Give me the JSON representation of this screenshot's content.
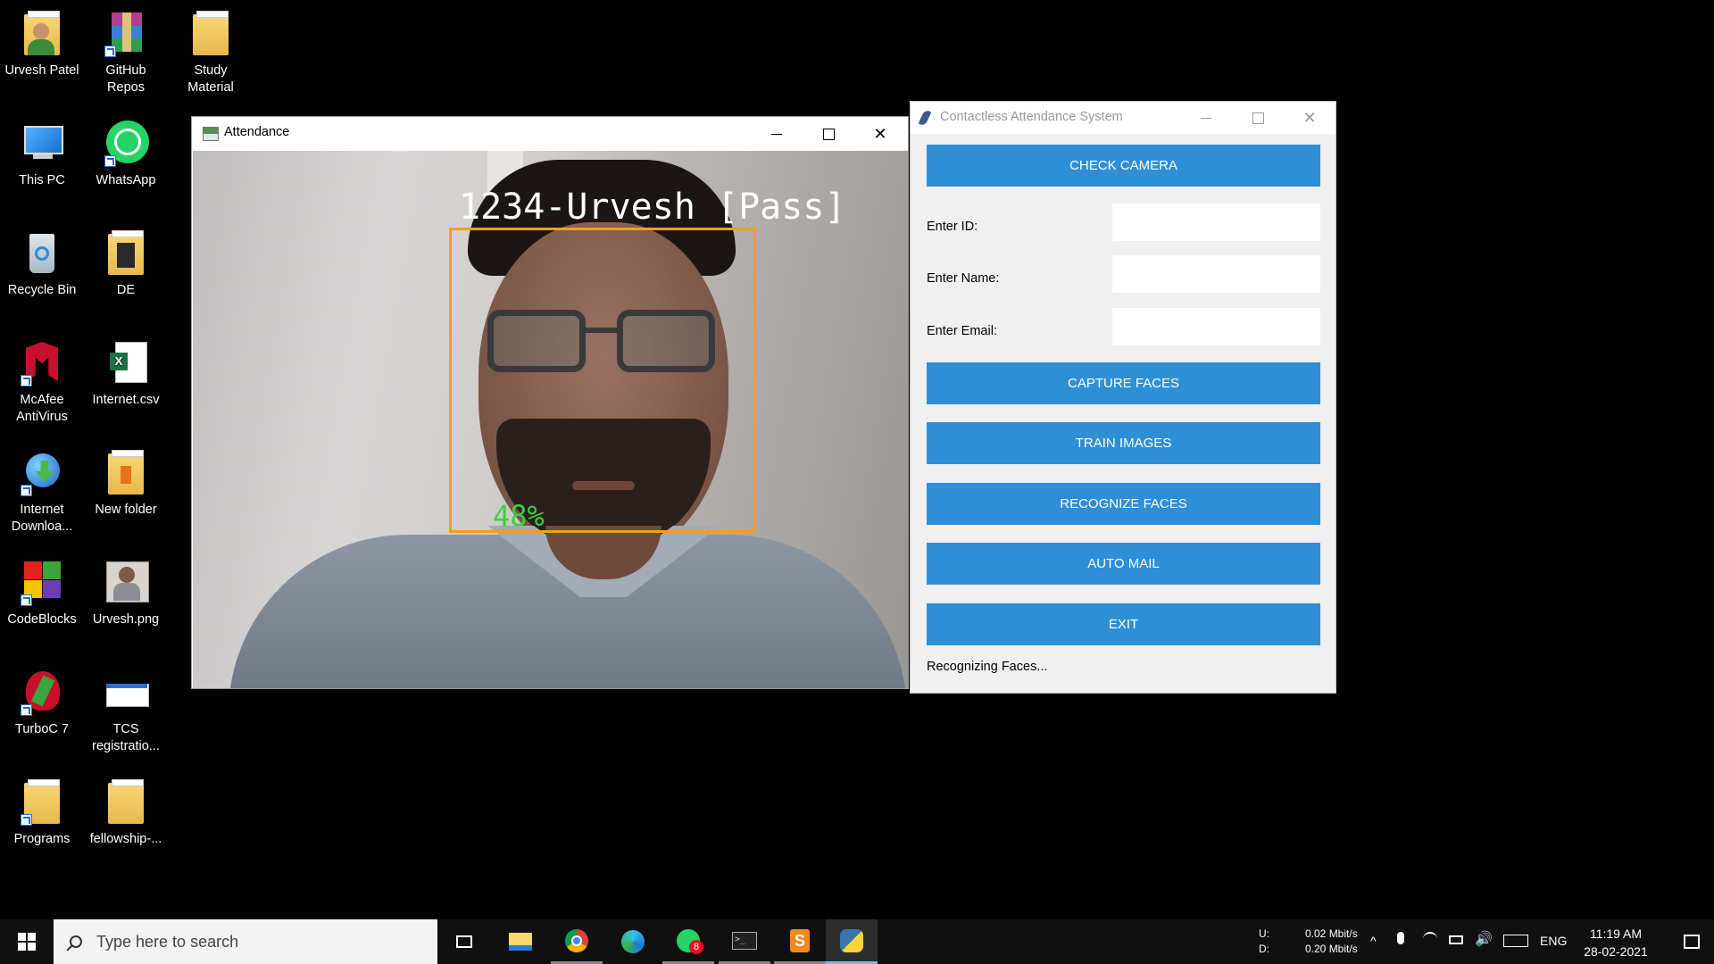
{
  "desktop": {
    "icons": [
      {
        "label_1": "Urvesh Patel",
        "label_2": "",
        "icon": "user-folder-icon"
      },
      {
        "label_1": "GitHub",
        "label_2": "Repos",
        "icon": "winrar-archive-icon"
      },
      {
        "label_1": "Study",
        "label_2": "Material",
        "icon": "folder-icon"
      },
      {
        "label_1": "This PC",
        "label_2": "",
        "icon": "computer-icon"
      },
      {
        "label_1": "WhatsApp",
        "label_2": "",
        "icon": "whatsapp-icon"
      },
      {
        "label_1": "Recycle Bin",
        "label_2": "",
        "icon": "recycle-bin-icon"
      },
      {
        "label_1": "DE",
        "label_2": "",
        "icon": "folder-icon"
      },
      {
        "label_1": "McAfee",
        "label_2": "AntiVirus",
        "icon": "mcafee-icon"
      },
      {
        "label_1": "Internet.csv",
        "label_2": "",
        "icon": "excel-csv-icon"
      },
      {
        "label_1": "Internet",
        "label_2": "Downloa...",
        "icon": "internet-download-manager-icon"
      },
      {
        "label_1": "New folder",
        "label_2": "",
        "icon": "folder-icon"
      },
      {
        "label_1": "CodeBlocks",
        "label_2": "",
        "icon": "codeblocks-icon"
      },
      {
        "label_1": "Urvesh.png",
        "label_2": "",
        "icon": "image-file-icon"
      },
      {
        "label_1": "TurboC 7",
        "label_2": "",
        "icon": "turboc-icon"
      },
      {
        "label_1": "TCS",
        "label_2": "registratio...",
        "icon": "document-icon"
      },
      {
        "label_1": "Programs",
        "label_2": "",
        "icon": "folder-icon"
      },
      {
        "label_1": "fellowship-...",
        "label_2": "",
        "icon": "folder-icon"
      }
    ]
  },
  "attendance_window": {
    "title": "Attendance",
    "overlay_label": "1234-Urvesh [Pass]",
    "confidence": "48%",
    "box_color": "#f0a020",
    "confidence_color": "#3ad13a"
  },
  "cas_window": {
    "title": "Contactless Attendance System",
    "check_camera": "CHECK CAMERA",
    "id_label": "Enter ID:",
    "name_label": "Enter Name:",
    "email_label": "Enter Email:",
    "id_value": "",
    "name_value": "",
    "email_value": "",
    "capture_faces": "CAPTURE FACES",
    "train_images": "TRAIN IMAGES",
    "recognize_faces": "RECOGNIZE FACES",
    "auto_mail": "AUTO MAIL",
    "exit": "EXIT",
    "status": "Recognizing Faces...",
    "button_color": "#2e8fd6"
  },
  "taskbar": {
    "search_placeholder": "Type here to search",
    "net_up_label": "U:",
    "net_down_label": "D:",
    "net_up_value": "0.02 Mbit/s",
    "net_down_value": "0.20 Mbit/s",
    "language": "ENG",
    "time": "11:19 AM",
    "date": "28-02-2021",
    "whatsapp_badge": "8"
  }
}
